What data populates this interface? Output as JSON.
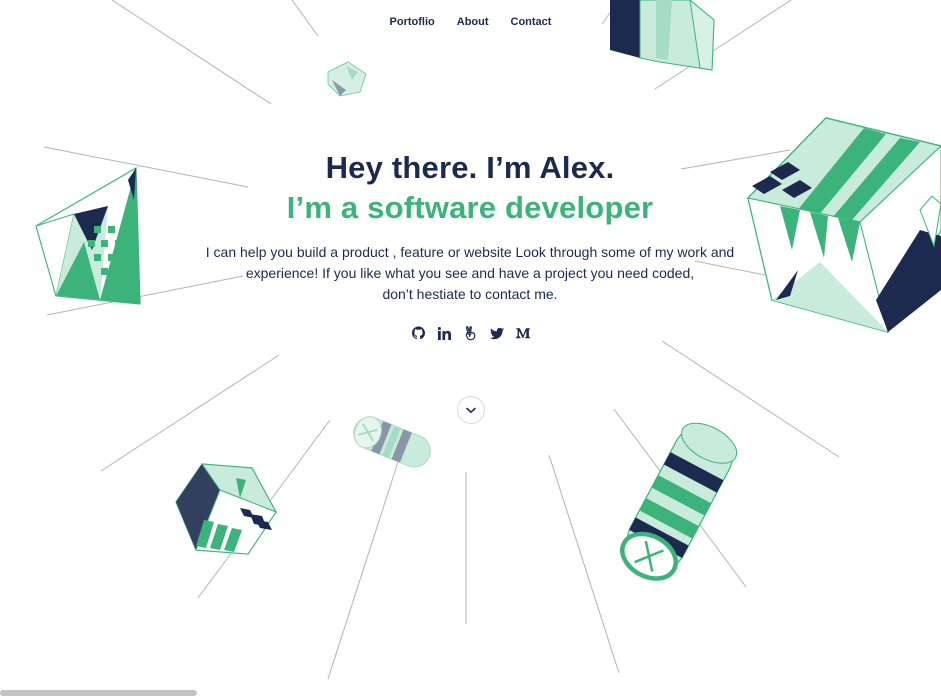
{
  "nav": {
    "items": [
      "Portoflio",
      "About",
      "Contact"
    ]
  },
  "hero": {
    "greeting": "Hey there. I’m Alex.",
    "role": "I’m a software developer",
    "description": [
      "I can help you build a product , feature or website Look through some of my work and",
      "experience! If you like what you see and have a project you need coded,",
      "don’t hestiate to contact me."
    ]
  },
  "social": [
    {
      "name": "github-icon",
      "label": "GitHub"
    },
    {
      "name": "linkedin-icon",
      "label": "LinkedIn"
    },
    {
      "name": "angellist-icon",
      "label": "AngelList"
    },
    {
      "name": "twitter-icon",
      "label": "Twitter"
    },
    {
      "name": "medium-icon",
      "label": "Medium"
    }
  ],
  "scroll_icon": "chevron-down-icon",
  "colors": {
    "navy": "#1b2a4e",
    "green": "#3db37c",
    "mint": "#c9ebdb",
    "line": "#b5b5b5"
  }
}
